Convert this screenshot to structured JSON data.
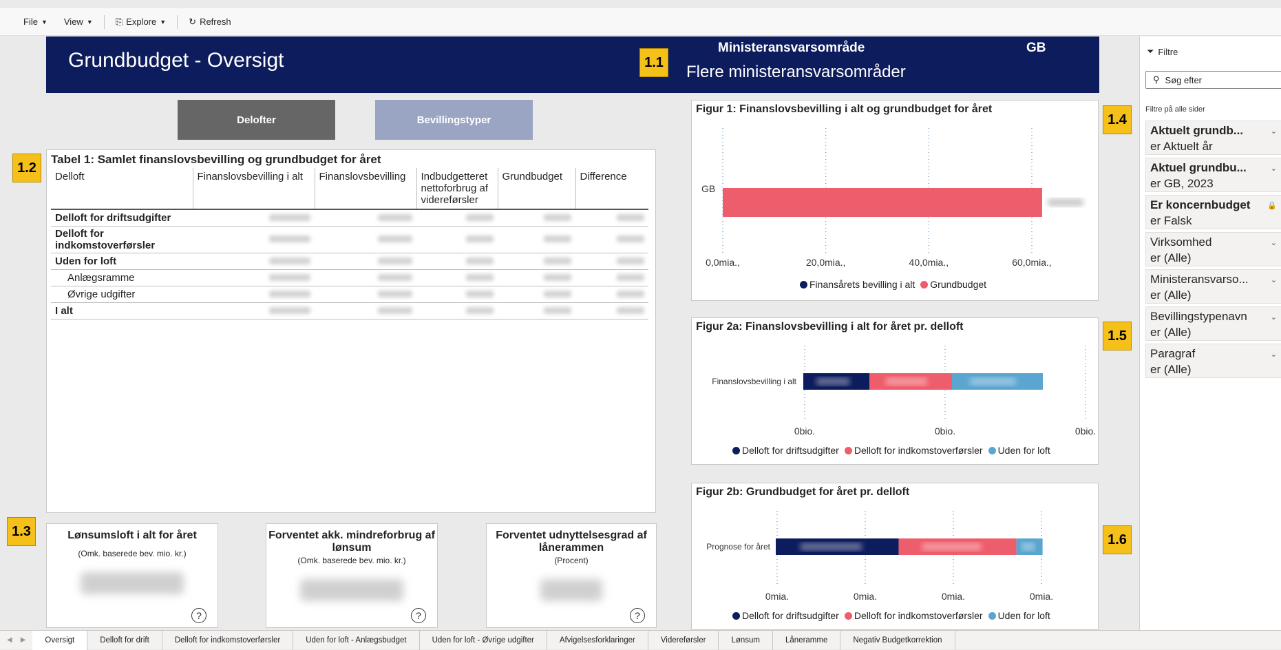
{
  "toolbar": {
    "file": "File",
    "view": "View",
    "explore": "Explore",
    "refresh": "Refresh"
  },
  "header": {
    "title": "Grundbudget - Oversigt",
    "ministry_label": "Ministeransvarsområde",
    "gb": "GB",
    "ministry_value": "Flere ministeransvarsområder"
  },
  "badges": [
    "1.1",
    "1.2",
    "1.3",
    "1.4",
    "1.5",
    "1.6"
  ],
  "nav_buttons": {
    "delofter": "Delofter",
    "bevillingstyper": "Bevillingstyper"
  },
  "table1": {
    "title": "Tabel 1: Samlet finanslovsbevilling og grundbudget for året",
    "columns": [
      "Delloft",
      "Finanslovsbevilling i alt",
      "Finanslovsbevilling",
      "Indbudgetteret nettoforbrug af videreførsler",
      "Grundbudget",
      "Difference"
    ],
    "rows": [
      {
        "label": "Delloft for driftsudgifter",
        "indent": false
      },
      {
        "label": "Delloft for indkomstoverførsler",
        "indent": false
      },
      {
        "label": "Uden for loft",
        "indent": false
      },
      {
        "label": "Anlægsramme",
        "indent": true
      },
      {
        "label": "Øvrige udgifter",
        "indent": true
      },
      {
        "label": "I alt",
        "indent": false
      }
    ]
  },
  "cards": [
    {
      "title": "Lønsumsloft i alt for året",
      "subtitle": "(Omk. baserede bev. mio. kr.)"
    },
    {
      "title": "Forventet akk. mindreforbrug af lønsum",
      "subtitle": "(Omk. baserede bev. mio. kr.)"
    },
    {
      "title": "Forventet udnyttelsesgrad af lånerammen",
      "subtitle": "(Procent)"
    }
  ],
  "help_icon": "?",
  "colors": {
    "navy": "#0d1c5c",
    "red": "#ee5d6b",
    "blue": "#5ba6d0",
    "dark_btn": "#666666",
    "light_btn": "#9aa5c4",
    "badge": "#f5c01a"
  },
  "chart_data": [
    {
      "type": "bar",
      "title": "Figur 1: Finanslovsbevilling i alt og grundbudget for året",
      "categories": [
        "GB"
      ],
      "series": [
        {
          "name": "Finansårets bevilling i alt",
          "values": [
            0
          ]
        },
        {
          "name": "Grundbudget",
          "values": [
            62
          ]
        }
      ],
      "xticks": [
        "0,0mia.,",
        "20,0mia.,",
        "40,0mia.,",
        "60,0mia.,"
      ],
      "xlim": [
        0,
        60
      ],
      "orientation": "horizontal",
      "grid": "dotted vertical",
      "legend": "bottom"
    },
    {
      "type": "bar",
      "stacked": true,
      "title": "Figur 2a: Finanslovsbevilling i alt for året pr. delloft",
      "categories": [
        "Finanslovsbevilling i alt"
      ],
      "series": [
        {
          "name": "Delloft for driftsudgifter",
          "values": [
            0.24
          ]
        },
        {
          "name": "Delloft for indkomstoverførsler",
          "values": [
            0.3
          ]
        },
        {
          "name": "Uden for loft",
          "values": [
            0.33
          ]
        }
      ],
      "xticks": [
        "0bio.",
        "0bio.",
        "0bio."
      ],
      "orientation": "horizontal",
      "grid": "dotted vertical",
      "legend": "bottom"
    },
    {
      "type": "bar",
      "stacked": true,
      "title": "Figur 2b: Grundbudget for året pr. delloft",
      "categories": [
        "Prognose for året"
      ],
      "series": [
        {
          "name": "Delloft for driftsudgifter",
          "values": [
            0.47
          ]
        },
        {
          "name": "Delloft for indkomstoverførsler",
          "values": [
            0.45
          ]
        },
        {
          "name": "Uden for loft",
          "values": [
            0.1
          ]
        }
      ],
      "xticks": [
        "0mia.",
        "0mia.",
        "0mia.",
        "0mia."
      ],
      "orientation": "horizontal",
      "grid": "dotted vertical",
      "legend": "bottom"
    }
  ],
  "filters": {
    "header": "Filtre",
    "search_placeholder": "Søg efter",
    "section": "Filtre på alle sider",
    "items": [
      {
        "name": "Aktuelt grundb...",
        "value": "er Aktuelt år",
        "bold": true
      },
      {
        "name": "Aktuel grundbu...",
        "value": "er GB, 2023",
        "bold": true
      },
      {
        "name": "Er koncernbudget",
        "value": "er Falsk",
        "bold": true
      },
      {
        "name": "Virksomhed",
        "value": "er (Alle)",
        "bold": false
      },
      {
        "name": "Ministeransvarso...",
        "value": "er (Alle)",
        "bold": false
      },
      {
        "name": "Bevillingstypenavn",
        "value": "er (Alle)",
        "bold": false
      },
      {
        "name": "Paragraf",
        "value": "er (Alle)",
        "bold": false
      }
    ]
  },
  "tabs": [
    "Oversigt",
    "Delloft for drift",
    "Delloft for indkomstoverførsler",
    "Uden for loft - Anlægsbudget",
    "Uden for loft - Øvrige udgifter",
    "Afvigelsesforklaringer",
    "Videreførsler",
    "Lønsum",
    "Låneramme",
    "Negativ Budgetkorrektion"
  ]
}
